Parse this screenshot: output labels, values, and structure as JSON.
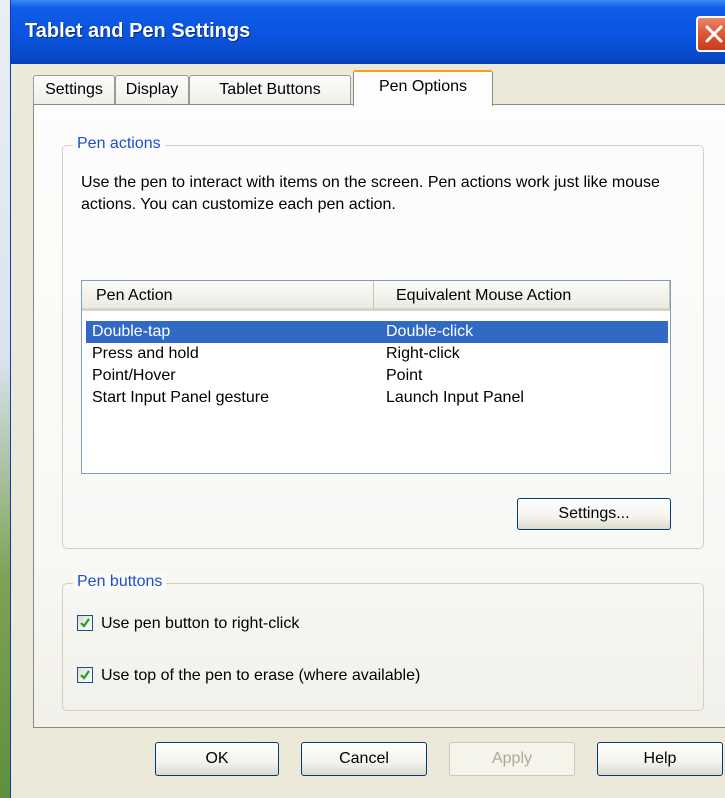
{
  "window": {
    "title": "Tablet and Pen Settings"
  },
  "tabs": [
    {
      "label": "Settings",
      "active": false
    },
    {
      "label": "Display",
      "active": false
    },
    {
      "label": "Tablet Buttons",
      "active": false
    },
    {
      "label": "Pen Options",
      "active": true
    }
  ],
  "pen_actions": {
    "legend": "Pen actions",
    "description": "Use the pen to interact with items on the screen. Pen actions work just like mouse actions. You can customize each pen action.",
    "columns": [
      "Pen Action",
      "Equivalent Mouse Action"
    ],
    "rows": [
      {
        "action": "Double-tap",
        "mouse": "Double-click",
        "selected": true
      },
      {
        "action": "Press and hold",
        "mouse": "Right-click",
        "selected": false
      },
      {
        "action": "Point/Hover",
        "mouse": "Point",
        "selected": false
      },
      {
        "action": "Start Input Panel gesture",
        "mouse": "Launch Input Panel",
        "selected": false
      }
    ],
    "settings_button": "Settings..."
  },
  "pen_buttons": {
    "legend": "Pen buttons",
    "options": [
      {
        "label": "Use pen button to right-click",
        "checked": true
      },
      {
        "label": "Use top of the pen to erase (where available)",
        "checked": true
      }
    ]
  },
  "footer": {
    "ok": "OK",
    "cancel": "Cancel",
    "apply": "Apply",
    "help": "Help"
  },
  "colors": {
    "title_bar": "#0a54de",
    "selection": "#316ac5",
    "group_legend": "#1e4fcf",
    "active_tab_accent": "#f5a316",
    "close_button": "#d9532e"
  }
}
